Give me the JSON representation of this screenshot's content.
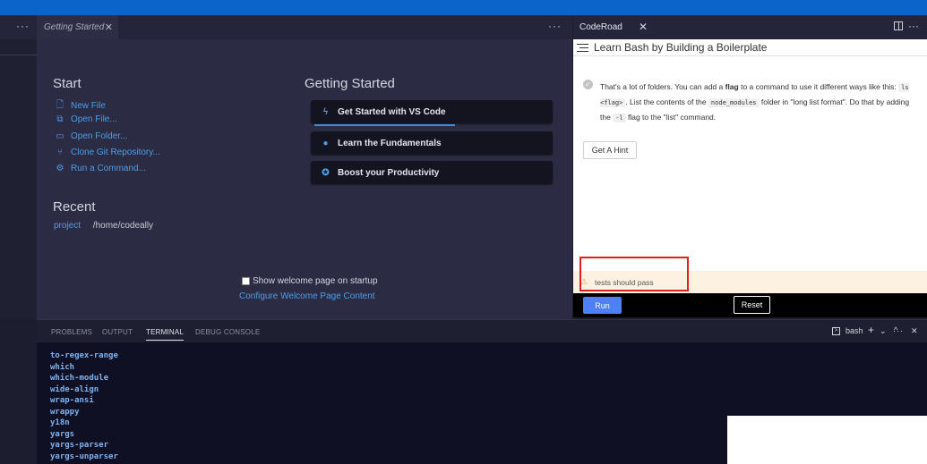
{
  "editor": {
    "tab_label": "Getting Started",
    "more": "···"
  },
  "welcome": {
    "start_heading": "Start",
    "start_items": [
      {
        "label": "New File",
        "icon": "new-file-icon"
      },
      {
        "label": "Open File...",
        "icon": "open-file-icon"
      },
      {
        "label": "Open Folder...",
        "icon": "open-folder-icon"
      },
      {
        "label": "Clone Git Repository...",
        "icon": "git-clone-icon"
      },
      {
        "label": "Run a Command...",
        "icon": "run-command-icon"
      }
    ],
    "recent_heading": "Recent",
    "recent_project": "project",
    "recent_path": "/home/codeally",
    "getting_started_heading": "Getting Started",
    "cards": [
      {
        "label": "Get Started with VS Code",
        "icon": "lightning-icon"
      },
      {
        "label": "Learn the Fundamentals",
        "icon": "bulb-icon"
      },
      {
        "label": "Boost your Productivity",
        "icon": "productivity-icon"
      }
    ],
    "show_on_startup": "Show welcome page on startup",
    "configure_link": "Configure Welcome Page Content"
  },
  "coderoad": {
    "title": "CodeRoad",
    "lesson_title": "Learn Bash by Building a Boilerplate",
    "desc_1": "That's a lot of folders. You can add a ",
    "desc_flag": "flag",
    "desc_2": " to a command to use it different ways like this:",
    "desc_code1": "ls <flag>",
    "desc_3": ". List the contents of the ",
    "desc_code2": "node_modules",
    "desc_4": " folder in \"long list format\". Do that by adding the ",
    "desc_code3": "-l",
    "desc_5": " flag to the \"list\" command.",
    "hint_button": "Get A Hint",
    "warning": "tests should pass",
    "run_button": "Run",
    "reset_button": "Reset"
  },
  "panel": {
    "tabs": [
      "PROBLEMS",
      "OUTPUT",
      "TERMINAL",
      "DEBUG CONSOLE"
    ],
    "active_tab": "TERMINAL",
    "shell": "bash",
    "terminal_lines": [
      "to-regex-range",
      "which",
      "which-module",
      "wide-align",
      "wrap-ansi",
      "wrappy",
      "y18n",
      "yargs",
      "yargs-parser",
      "yargs-unparser"
    ]
  },
  "colors": {
    "accent": "#0a64c9",
    "link": "#4e9de8",
    "run": "#4f7ff4",
    "highlight_box": "#e01f1f"
  }
}
